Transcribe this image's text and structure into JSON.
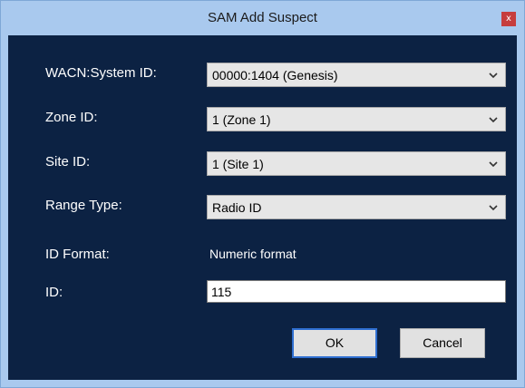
{
  "window": {
    "title": "SAM Add Suspect",
    "close_glyph": "x"
  },
  "form": {
    "wacn_label": "WACN:System ID:",
    "wacn_value": "00000:1404 (Genesis)",
    "zone_label": "Zone ID:",
    "zone_value": "1 (Zone 1)",
    "site_label": "Site ID:",
    "site_value": "1 (Site 1)",
    "range_label": "Range Type:",
    "range_value": "Radio ID",
    "format_label": "ID Format:",
    "format_value": "Numeric format",
    "id_label": "ID:",
    "id_value": "115"
  },
  "buttons": {
    "ok": "OK",
    "cancel": "Cancel"
  },
  "colors": {
    "titlebar": "#a9c9ee",
    "client_background": "#0c2243",
    "close_button": "#c63d3d",
    "default_button_border": "#2f6fd1"
  },
  "icons": {
    "dropdown": "chevron-down-icon",
    "close": "close-icon"
  }
}
